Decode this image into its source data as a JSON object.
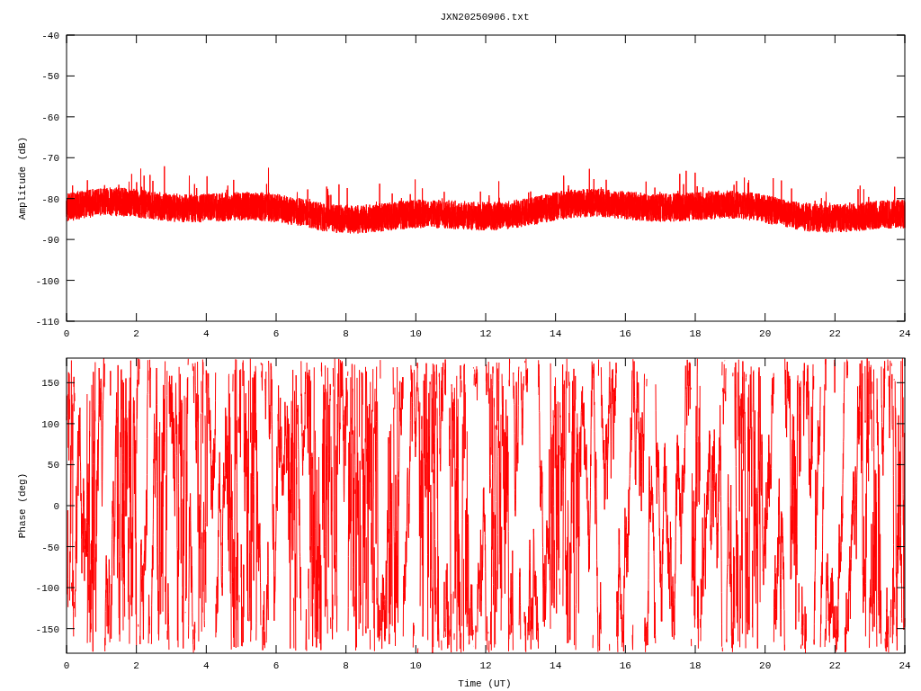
{
  "title": "JXN20250906.txt",
  "panels": [
    {
      "kind": "amplitude",
      "ylabel": "Amplitude (dB)",
      "yticks": [
        "-40",
        "-50",
        "-60",
        "-70",
        "-80",
        "-90",
        "-100",
        "-110"
      ],
      "xticks": [
        "0",
        "2",
        "4",
        "6",
        "8",
        "10",
        "12",
        "14",
        "16",
        "18",
        "20",
        "22",
        "24"
      ]
    },
    {
      "kind": "phase",
      "ylabel": "Phase (deg)",
      "yticks": [
        "150",
        "100",
        "50",
        "0",
        "-50",
        "-100",
        "-150"
      ],
      "xticks": [
        "0",
        "2",
        "4",
        "6",
        "8",
        "10",
        "12",
        "14",
        "16",
        "18",
        "20",
        "22",
        "24"
      ],
      "xlabel": "Time (UT)"
    }
  ]
}
